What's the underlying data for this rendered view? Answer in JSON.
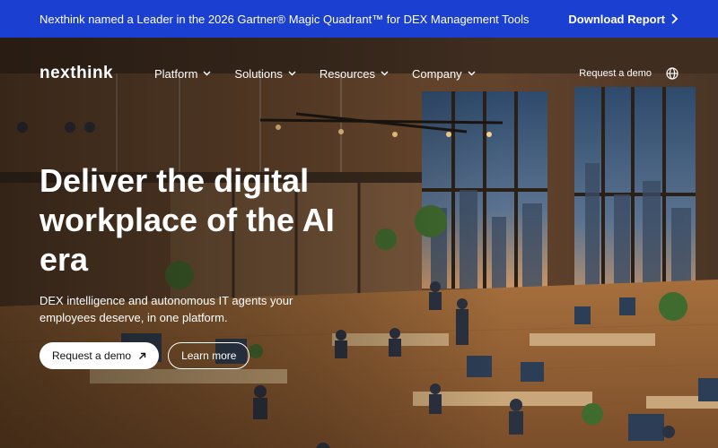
{
  "announcement": {
    "message": "Nexthink named a Leader in the 2026 Gartner® Magic Quadrant™ for DEX Management Tools",
    "link_label": "Download Report"
  },
  "nav": {
    "logo": "nexthink",
    "menu": [
      {
        "label": "Platform"
      },
      {
        "label": "Solutions"
      },
      {
        "label": "Resources"
      },
      {
        "label": "Company"
      }
    ],
    "request_demo": "Request a demo",
    "globe_icon": "globe-icon"
  },
  "hero": {
    "headline": "Deliver the digital workplace of the AI era",
    "subheadline": "DEX intelligence and autonomous IT agents your employees deserve, in one platform.",
    "primary_cta": "Request a demo",
    "secondary_cta": "Learn more"
  },
  "colors": {
    "announcement_bg": "#1b3fd0",
    "text": "#ffffff",
    "button_primary_bg": "#ffffff"
  }
}
